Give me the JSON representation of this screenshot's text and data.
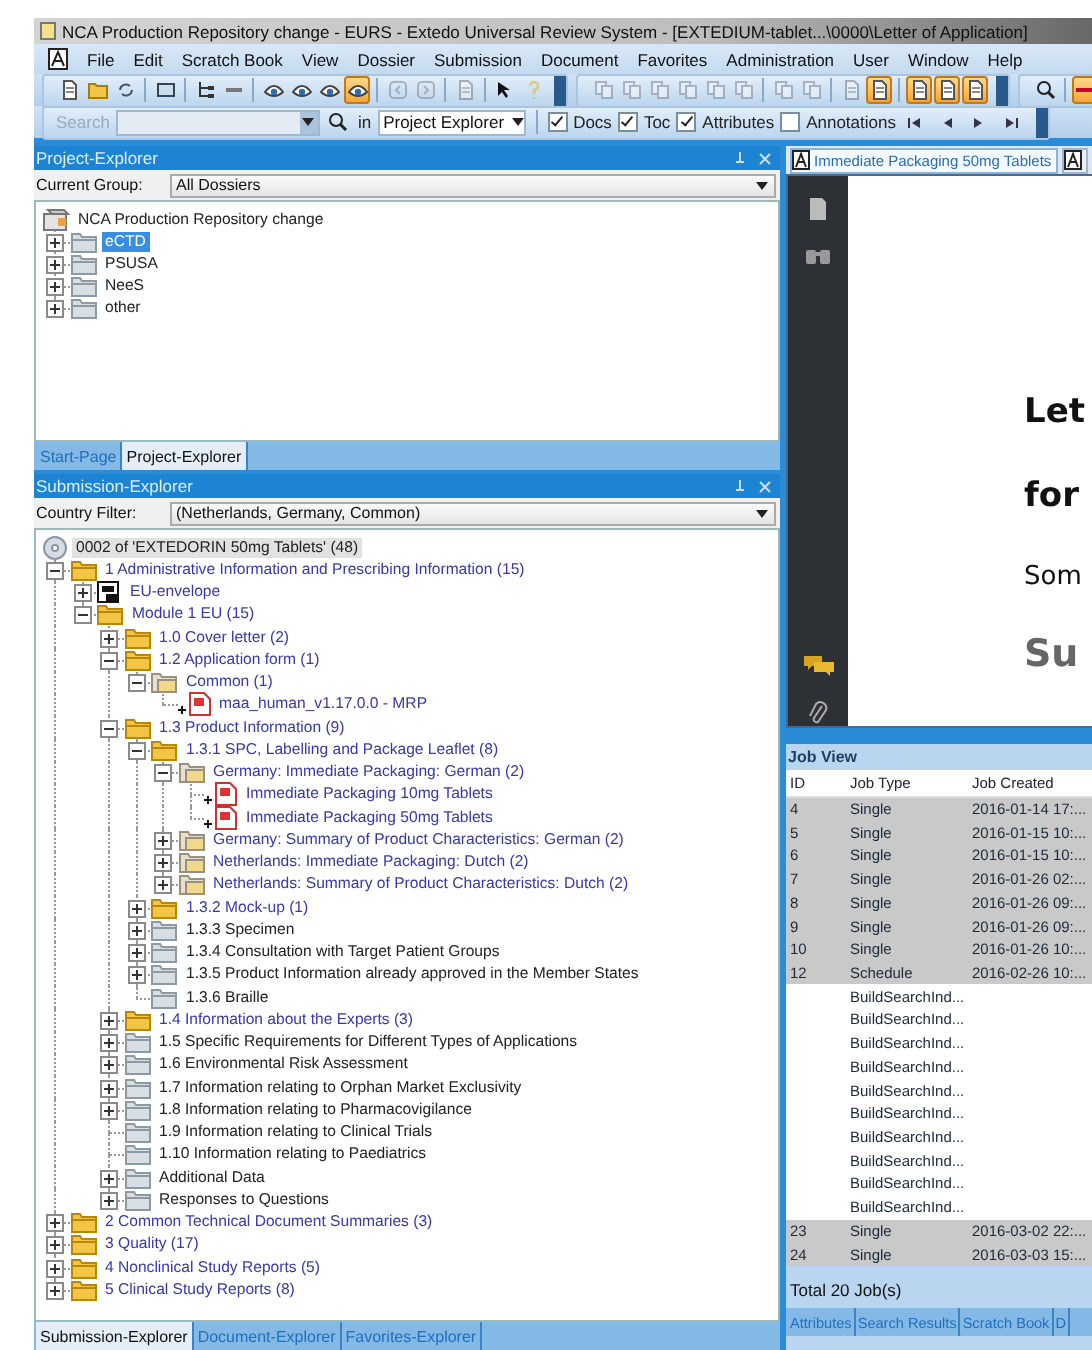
{
  "window": {
    "title": "NCA Production Repository change - EURS - Extedo Universal Review System - [EXTEDIUM-tablet...\\0000\\Letter of Application]"
  },
  "menu": [
    "File",
    "Edit",
    "Scratch Book",
    "View",
    "Dossier",
    "Submission",
    "Document",
    "Favorites",
    "Administration",
    "User",
    "Window",
    "Help"
  ],
  "toolbars": [
    {
      "groups": [
        [
          {
            "on": false,
            "disabled": false
          },
          {
            "on": false,
            "disabled": false
          },
          {
            "on": false,
            "disabled": false
          }
        ],
        [
          {
            "on": false,
            "disabled": false
          }
        ],
        [
          {
            "on": false,
            "disabled": false
          },
          {
            "on": false,
            "disabled": false
          }
        ],
        [
          {
            "on": false,
            "disabled": false
          },
          {
            "on": false,
            "disabled": false
          },
          {
            "on": false,
            "disabled": false
          },
          {
            "on": true,
            "disabled": false
          }
        ],
        [
          {
            "on": false,
            "disabled": true
          },
          {
            "on": false,
            "disabled": true
          }
        ],
        [
          {
            "on": false,
            "disabled": true
          }
        ],
        [
          {
            "on": false,
            "disabled": false
          },
          {
            "on": false,
            "disabled": true
          }
        ]
      ]
    },
    {
      "groups": [
        [
          {
            "on": false,
            "disabled": true
          },
          {
            "on": false,
            "disabled": true
          },
          {
            "on": false,
            "disabled": true
          },
          {
            "on": false,
            "disabled": true
          },
          {
            "on": false,
            "disabled": true
          },
          {
            "on": false,
            "disabled": true
          }
        ],
        [
          {
            "on": false,
            "disabled": true
          },
          {
            "on": false,
            "disabled": true
          }
        ],
        [
          {
            "on": false,
            "disabled": true
          },
          {
            "on": true,
            "disabled": false
          }
        ],
        [
          {
            "on": true,
            "disabled": false
          },
          {
            "on": true,
            "disabled": false
          },
          {
            "on": true,
            "disabled": false
          }
        ]
      ]
    },
    {
      "groups": [
        [
          {
            "on": false,
            "disabled": false
          }
        ],
        [
          {
            "on": true,
            "disabled": false
          }
        ]
      ]
    }
  ],
  "search_bar": {
    "label": "Search",
    "in_label": "in",
    "scope": "Project Explorer",
    "options": [
      {
        "label": "Docs",
        "checked": true
      },
      {
        "label": "Toc",
        "checked": true
      },
      {
        "label": "Attributes",
        "checked": true
      },
      {
        "label": "Annotations",
        "checked": false
      }
    ]
  },
  "project_explorer": {
    "title": "Project-Explorer",
    "group_label": "Current Group:",
    "group": "All Dossiers",
    "tree": [
      {
        "label": "NCA Production Repository change",
        "kind": "repository",
        "selected": false,
        "children": [
          {
            "label": "eCTD",
            "kind": "folder",
            "has_content": false,
            "selected": true,
            "expanded": false
          },
          {
            "label": "PSUSA",
            "kind": "folder",
            "has_content": false,
            "selected": false,
            "expanded": false
          },
          {
            "label": "NeeS",
            "kind": "folder",
            "has_content": false,
            "selected": false,
            "expanded": false
          },
          {
            "label": "other",
            "kind": "folder",
            "has_content": false,
            "selected": false,
            "expanded": false
          }
        ]
      }
    ],
    "tabs": [
      {
        "label": "Start-Page",
        "selected": false
      },
      {
        "label": "Project-Explorer",
        "selected": true
      }
    ]
  },
  "submission_explorer": {
    "title": "Submission-Explorer",
    "filter_label": "Country Filter:",
    "filter": "(Netherlands, Germany, Common)",
    "tree": [
      {
        "label": "0002 of 'EXTEDORIN 50mg Tablets' (48)",
        "kind": "submission",
        "selected": true,
        "children": [
          {
            "label": "1 Administrative Information and Prescribing Information (15)",
            "kind": "folder",
            "has_content": true,
            "selected": false,
            "expanded": true,
            "children": [
              {
                "label": "EU-envelope",
                "kind": "envelope",
                "has_content": true,
                "selected": false,
                "expanded": false
              },
              {
                "label": "Module 1 EU (15)",
                "kind": "folder",
                "has_content": true,
                "selected": false,
                "expanded": true,
                "children": [
                  {
                    "label": "1.0 Cover letter (2)",
                    "kind": "folder",
                    "has_content": true,
                    "selected": false,
                    "expanded": false
                  },
                  {
                    "label": "1.2 Application form (1)",
                    "kind": "folder",
                    "has_content": true,
                    "selected": false,
                    "expanded": true,
                    "children": [
                      {
                        "label": "Common (1)",
                        "kind": "country-folder",
                        "has_content": true,
                        "selected": false,
                        "expanded": true,
                        "children": [
                          {
                            "label": "maa_human_v1.17.0.0 - MRP",
                            "kind": "document",
                            "has_content": true,
                            "selected": false
                          }
                        ]
                      }
                    ]
                  },
                  {
                    "label": "1.3 Product Information (9)",
                    "kind": "folder",
                    "has_content": true,
                    "selected": false,
                    "expanded": true,
                    "children": [
                      {
                        "label": "1.3.1 SPC, Labelling and Package Leaflet (8)",
                        "kind": "folder",
                        "has_content": true,
                        "selected": false,
                        "expanded": true,
                        "children": [
                          {
                            "label": "Germany: Immediate Packaging: German (2)",
                            "kind": "country-folder",
                            "has_content": true,
                            "selected": false,
                            "expanded": true,
                            "children": [
                              {
                                "label": "Immediate Packaging 10mg Tablets",
                                "kind": "document",
                                "has_content": true,
                                "selected": false
                              },
                              {
                                "label": "Immediate Packaging 50mg Tablets",
                                "kind": "document",
                                "has_content": true,
                                "selected": false
                              }
                            ]
                          },
                          {
                            "label": "Germany: Summary of Product Characteristics: German (2)",
                            "kind": "country-folder",
                            "has_content": true,
                            "selected": false,
                            "expanded": false
                          },
                          {
                            "label": "Netherlands: Immediate Packaging: Dutch (2)",
                            "kind": "country-folder",
                            "has_content": true,
                            "selected": false,
                            "expanded": false
                          },
                          {
                            "label": "Netherlands: Summary of Product Characteristics: Dutch (2)",
                            "kind": "country-folder",
                            "has_content": true,
                            "selected": false,
                            "expanded": false
                          }
                        ]
                      },
                      {
                        "label": "1.3.2 Mock-up (1)",
                        "kind": "folder",
                        "has_content": true,
                        "selected": false,
                        "expanded": false
                      },
                      {
                        "label": "1.3.3 Specimen",
                        "kind": "folder",
                        "has_content": false,
                        "selected": false,
                        "expanded": false
                      },
                      {
                        "label": "1.3.4 Consultation with Target Patient Groups",
                        "kind": "folder",
                        "has_content": false,
                        "selected": false,
                        "expanded": false
                      },
                      {
                        "label": "1.3.5 Product Information already approved in the Member States",
                        "kind": "folder",
                        "has_content": false,
                        "selected": false,
                        "expanded": false
                      },
                      {
                        "label": "1.3.6 Braille",
                        "kind": "folder",
                        "has_content": false,
                        "selected": false
                      }
                    ]
                  },
                  {
                    "label": "1.4 Information about the Experts (3)",
                    "kind": "folder",
                    "has_content": true,
                    "selected": false,
                    "expanded": false
                  },
                  {
                    "label": "1.5 Specific Requirements for Different Types of Applications",
                    "kind": "folder",
                    "has_content": false,
                    "selected": false,
                    "expanded": false
                  },
                  {
                    "label": "1.6 Environmental Risk Assessment",
                    "kind": "folder",
                    "has_content": false,
                    "selected": false,
                    "expanded": false
                  },
                  {
                    "label": "1.7 Information relating to Orphan Market Exclusivity",
                    "kind": "folder",
                    "has_content": false,
                    "selected": false,
                    "expanded": false
                  },
                  {
                    "label": "1.8 Information relating to Pharmacovigilance",
                    "kind": "folder",
                    "has_content": false,
                    "selected": false,
                    "expanded": false
                  },
                  {
                    "label": "1.9 Information relating to Clinical Trials",
                    "kind": "folder",
                    "has_content": false,
                    "selected": false
                  },
                  {
                    "label": "1.10 Information relating to Paediatrics",
                    "kind": "folder",
                    "has_content": false,
                    "selected": false
                  },
                  {
                    "label": "Additional Data",
                    "kind": "folder",
                    "has_content": false,
                    "selected": false,
                    "expanded": false
                  },
                  {
                    "label": "Responses to Questions",
                    "kind": "folder",
                    "has_content": false,
                    "selected": false,
                    "expanded": false
                  }
                ]
              }
            ]
          },
          {
            "label": "2 Common Technical Document Summaries (3)",
            "kind": "folder",
            "has_content": true,
            "selected": false,
            "expanded": false
          },
          {
            "label": "3 Quality (17)",
            "kind": "folder",
            "has_content": true,
            "selected": false,
            "expanded": false
          },
          {
            "label": "4 Nonclinical Study Reports (5)",
            "kind": "folder",
            "has_content": true,
            "selected": false,
            "expanded": false
          },
          {
            "label": "5 Clinical Study Reports (8)",
            "kind": "folder",
            "has_content": true,
            "selected": false,
            "expanded": false
          }
        ]
      }
    ],
    "tabs": [
      {
        "label": "Submission-Explorer",
        "selected": true
      },
      {
        "label": "Document-Explorer",
        "selected": false
      },
      {
        "label": "Favorites-Explorer",
        "selected": false
      }
    ]
  },
  "document_tabs": [
    {
      "label": "Immediate Packaging 50mg Tablets",
      "selected": true
    },
    {
      "selected": false
    }
  ],
  "document": {
    "lines": [
      {
        "text": "Let",
        "kind": "heading"
      },
      {
        "text": "for",
        "kind": "heading"
      },
      {
        "text": "Som",
        "kind": "body"
      },
      {
        "text": "Su",
        "kind": "subheading"
      }
    ]
  },
  "job_view": {
    "title": "Job View",
    "columns": [
      "ID",
      "Job Type",
      "Job Created"
    ],
    "rows": [
      {
        "id": "4",
        "job_type": "Single",
        "created": "2016-01-14 17:...",
        "selected": true
      },
      {
        "id": "5",
        "job_type": "Single",
        "created": "2016-01-15 10:...",
        "selected": true
      },
      {
        "id": "6",
        "job_type": "Single",
        "created": "2016-01-15 10:...",
        "selected": true
      },
      {
        "id": "7",
        "job_type": "Single",
        "created": "2016-01-26 02:...",
        "selected": true
      },
      {
        "id": "8",
        "job_type": "Single",
        "created": "2016-01-26 09:...",
        "selected": true
      },
      {
        "id": "9",
        "job_type": "Single",
        "created": "2016-01-26 09:...",
        "selected": true
      },
      {
        "id": "10",
        "job_type": "Single",
        "created": "2016-01-26 10:...",
        "selected": true
      },
      {
        "id": "12",
        "job_type": "Schedule",
        "created": "2016-02-26 10:...",
        "selected": true
      },
      {
        "job_type": "BuildSearchInd...",
        "selected": false
      },
      {
        "job_type": "BuildSearchInd...",
        "selected": false
      },
      {
        "job_type": "BuildSearchInd...",
        "selected": false
      },
      {
        "job_type": "BuildSearchInd...",
        "selected": false
      },
      {
        "job_type": "BuildSearchInd...",
        "selected": false
      },
      {
        "job_type": "BuildSearchInd...",
        "selected": false
      },
      {
        "job_type": "BuildSearchInd...",
        "selected": false
      },
      {
        "job_type": "BuildSearchInd...",
        "selected": false
      },
      {
        "job_type": "BuildSearchInd...",
        "selected": false
      },
      {
        "job_type": "BuildSearchInd...",
        "selected": false
      },
      {
        "id": "23",
        "job_type": "Single",
        "created": "2016-03-02 22:...",
        "selected": true
      },
      {
        "id": "24",
        "job_type": "Single",
        "created": "2016-03-03 15:...",
        "selected": true
      }
    ],
    "total": "Total 20 Job(s)",
    "tabs": [
      {
        "label": "Attributes",
        "selected": false
      },
      {
        "label": "Search Results",
        "selected": false
      },
      {
        "label": "Scratch Book",
        "selected": false
      },
      {
        "label": "D",
        "selected": false
      }
    ]
  }
}
